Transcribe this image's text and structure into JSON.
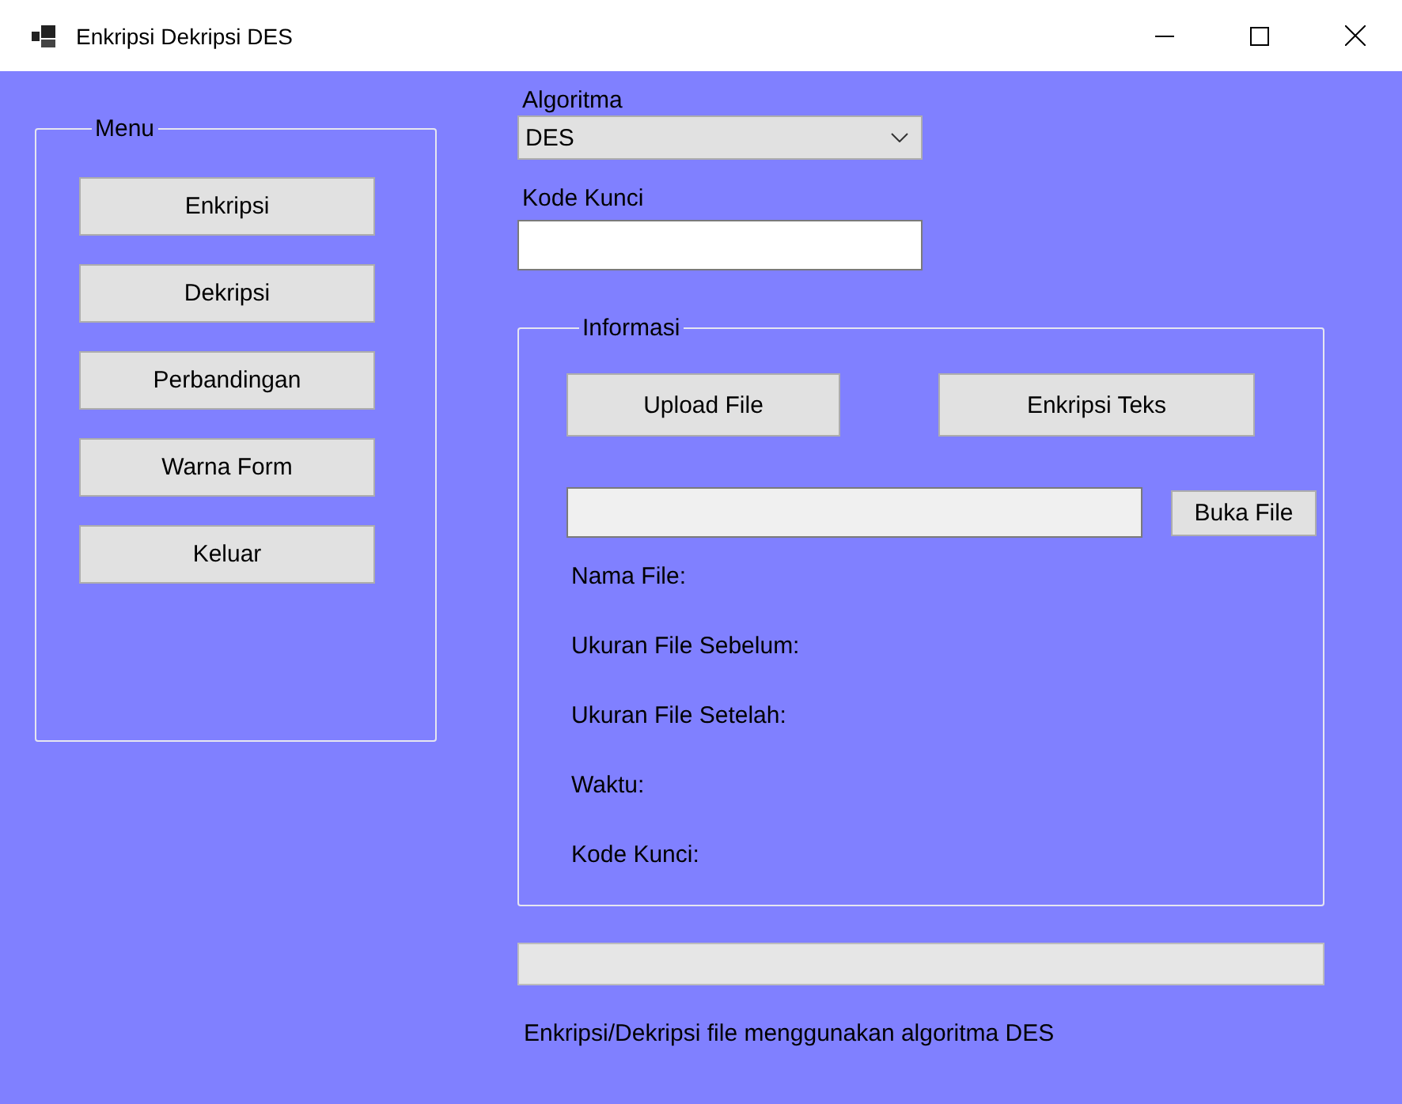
{
  "window": {
    "title": "Enkripsi Dekripsi DES"
  },
  "menu": {
    "title": "Menu",
    "buttons": [
      "Enkripsi",
      "Dekripsi",
      "Perbandingan",
      "Warna Form",
      "Keluar"
    ]
  },
  "algorithm": {
    "label": "Algoritma",
    "value": "DES"
  },
  "key": {
    "label": "Kode Kunci"
  },
  "info": {
    "title": "Informasi",
    "buttons": [
      "Upload File",
      "Enkripsi Teks"
    ],
    "open_button": "Buka File",
    "fields": [
      "Nama File:",
      "Ukuran File Sebelum:",
      "Ukuran File Setelah:",
      "Waktu:",
      "Kode Kunci:"
    ]
  },
  "progress": {
    "level": 0
  },
  "status": "Enkripsi/Dekripsi file menggunakan algoritma DES"
}
